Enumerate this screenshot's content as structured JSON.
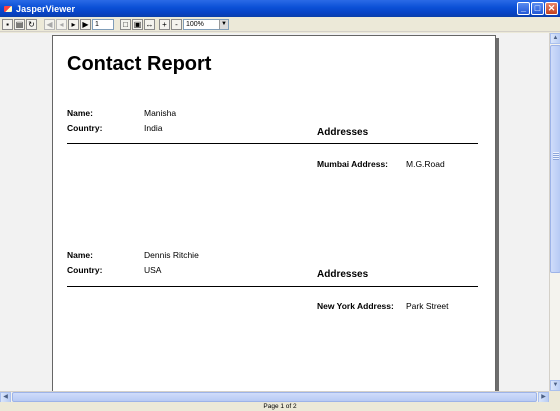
{
  "window": {
    "title": "JasperViewer",
    "minimize": "_",
    "maximize": "□",
    "close": "✕"
  },
  "toolbar": {
    "page_number": "1",
    "zoom": "100%",
    "icons": [
      "save-icon",
      "print-icon",
      "reload-icon",
      "first-page-icon",
      "previous-page-icon",
      "next-page-icon",
      "last-page-icon",
      "actual-size-icon",
      "fit-page-icon",
      "fit-width-icon",
      "zoom-in-icon",
      "zoom-out-icon"
    ]
  },
  "report": {
    "title": "Contact Report",
    "addresses_heading": "Addresses",
    "name_label": "Name:",
    "country_label": "Country:",
    "records": [
      {
        "name": "Manisha",
        "country": "India",
        "address_label": "Mumbai Address:",
        "address_value": "M.G.Road"
      },
      {
        "name": "Dennis Ritchie",
        "country": "USA",
        "address_label": "New York Address:",
        "address_value": "Park Street"
      }
    ]
  },
  "status": {
    "page_info": "Page 1 of 2"
  }
}
